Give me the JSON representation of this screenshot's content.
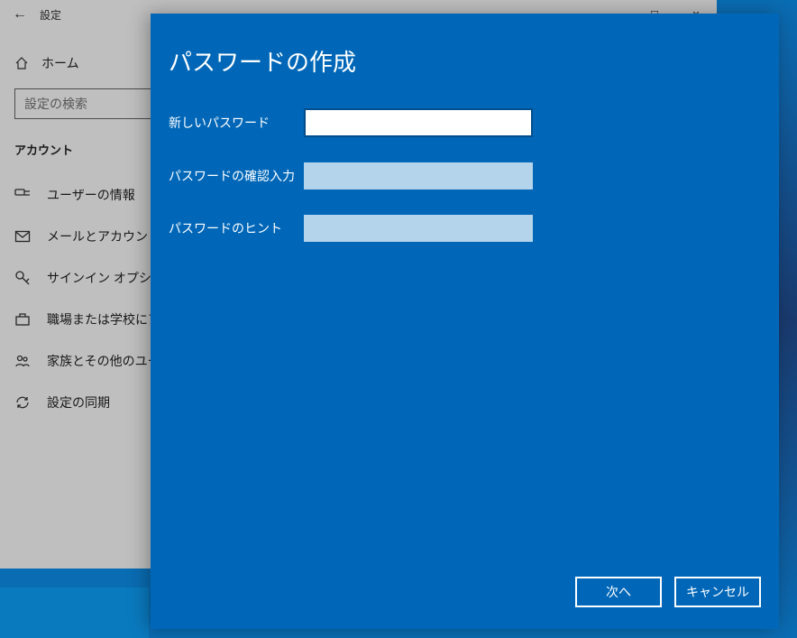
{
  "window": {
    "title": "設定",
    "controls": {
      "minimize": "—",
      "maximize": "☐",
      "close": "✕"
    }
  },
  "sidebar": {
    "home_label": "ホーム",
    "search_placeholder": "設定の検索",
    "section": "アカウント",
    "items": [
      {
        "label": "ユーザーの情報"
      },
      {
        "label": "メールとアカウント"
      },
      {
        "label": "サインイン オプション"
      },
      {
        "label": "職場または学校にアク"
      },
      {
        "label": "家族とその他のユーザ"
      },
      {
        "label": "設定の同期"
      }
    ]
  },
  "modal": {
    "title": "パスワードの作成",
    "fields": {
      "new_password_label": "新しいパスワード",
      "confirm_label": "パスワードの確認入力",
      "hint_label": "パスワードのヒント"
    },
    "buttons": {
      "next": "次へ",
      "cancel": "キャンセル"
    }
  }
}
